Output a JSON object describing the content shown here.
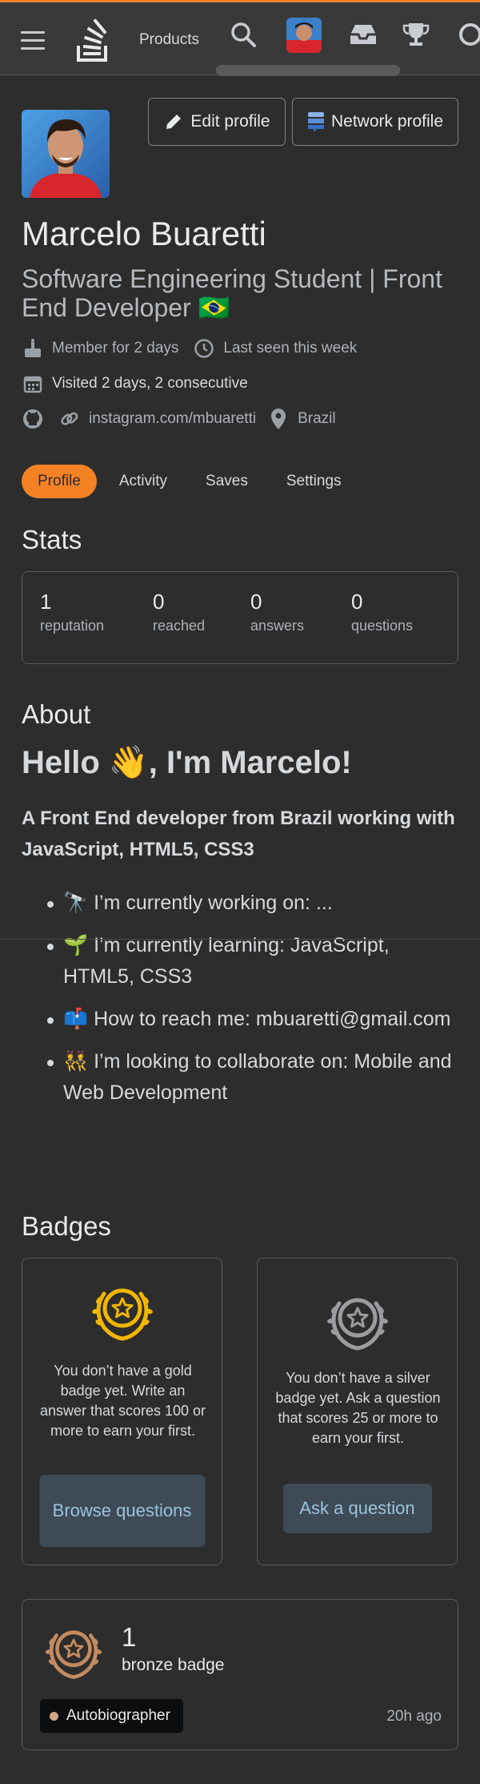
{
  "header": {
    "products_label": "Products"
  },
  "profile": {
    "name": "Marcelo Buaretti",
    "title": "Software Engineering Student | Front End Developer 🇧🇷",
    "edit_label": "Edit profile",
    "network_label": "Network profile",
    "member_for": "Member for 2 days",
    "last_seen": "Last seen this week",
    "visited": "Visited 2 days, 2 consecutive",
    "instagram": "instagram.com/mbuaretti",
    "location": "Brazil"
  },
  "tabs": [
    {
      "label": "Profile",
      "active": true
    },
    {
      "label": "Activity",
      "active": false
    },
    {
      "label": "Saves",
      "active": false
    },
    {
      "label": "Settings",
      "active": false
    }
  ],
  "stats": {
    "heading": "Stats",
    "items": [
      {
        "value": "1",
        "label": "reputation"
      },
      {
        "value": "0",
        "label": "reached"
      },
      {
        "value": "0",
        "label": "answers"
      },
      {
        "value": "0",
        "label": "questions"
      }
    ]
  },
  "about": {
    "heading": "About",
    "hello": "Hello 👋, I'm Marcelo!",
    "lead": "A Front End developer from Brazil working with JavaScript, HTML5, CSS3",
    "items": [
      "🔭 I’m currently working on: ...",
      "🌱 I’m currently learning: JavaScript, HTML5, CSS3",
      "📫 How to reach me: mbuaretti@gmail.com",
      "👯 I’m looking to collaborate on: Mobile and Web Development"
    ]
  },
  "badges": {
    "heading": "Badges",
    "gold": {
      "text": "You don’t have a gold badge yet. Write an answer that scores 100 or more to earn your first.",
      "button": "Browse questions",
      "color": "#f1b600"
    },
    "silver": {
      "text": "You don’t have a silver badge yet. Ask a question that scores 25 or more to earn your first.",
      "button": "Ask a question",
      "color": "#9a9c9f"
    },
    "bronze": {
      "count": "1",
      "label": "bronze badge",
      "badge_name": "Autobiographer",
      "earned": "20h ago",
      "color": "#c38b5f"
    }
  },
  "colors": {
    "accent": "#f48225",
    "background": "#2d2d2d",
    "link": "#9cc3db"
  }
}
